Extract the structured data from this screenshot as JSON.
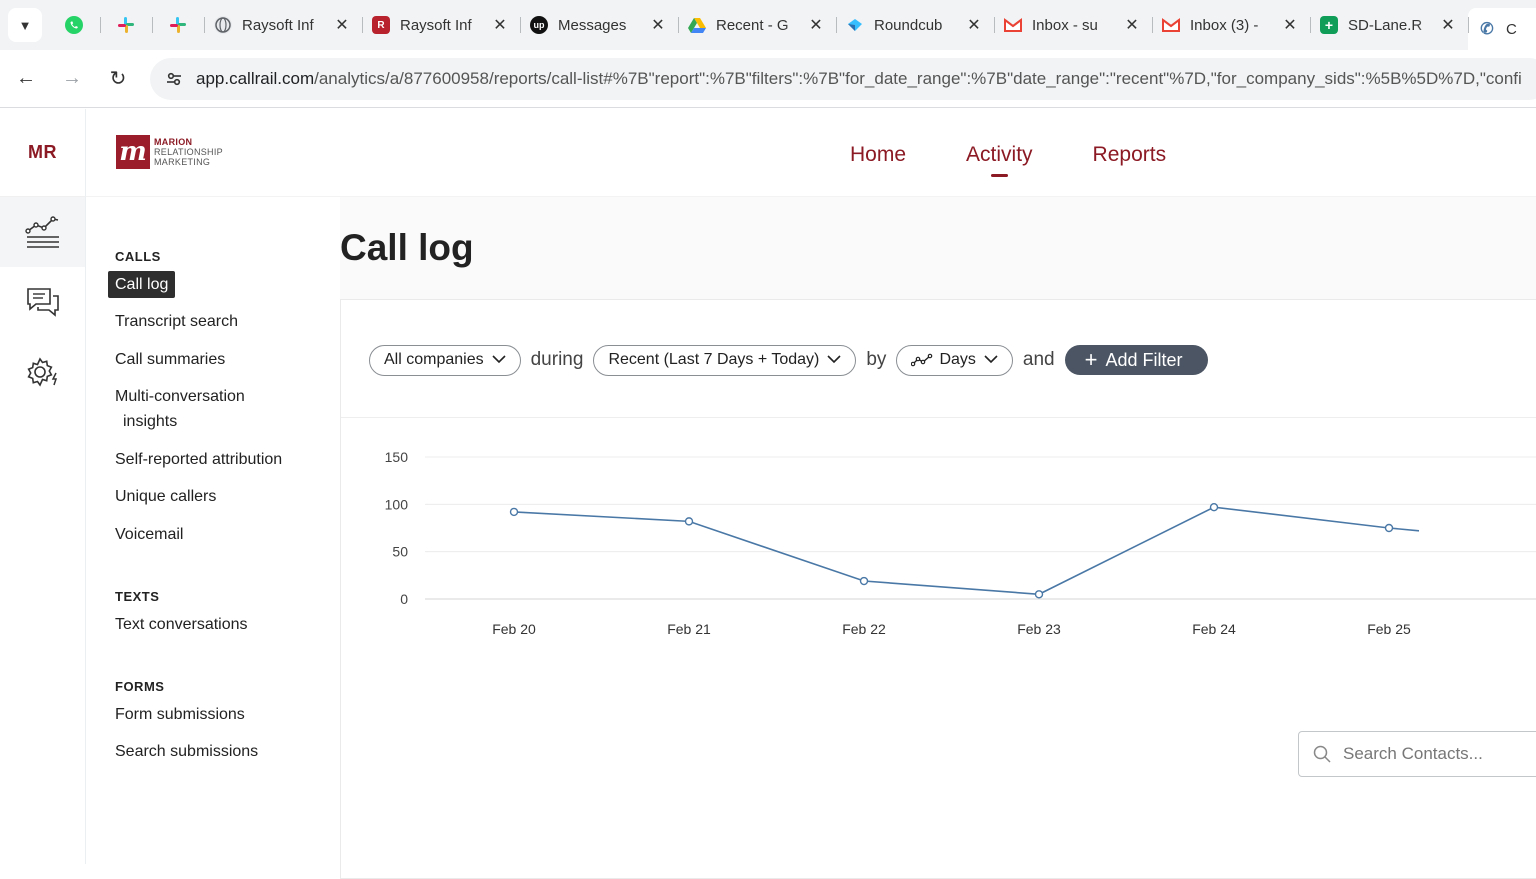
{
  "browser": {
    "tabs": [
      {
        "title": "Raysoft Inf",
        "favicon": "globe-icon"
      },
      {
        "title": "Raysoft Inf",
        "favicon": "raysoft-icon"
      },
      {
        "title": "Messages",
        "favicon": "upwork-icon"
      },
      {
        "title": "Recent - G",
        "favicon": "drive-icon"
      },
      {
        "title": "Roundcub",
        "favicon": "roundcube-icon"
      },
      {
        "title": "Inbox - su",
        "favicon": "gmail-icon"
      },
      {
        "title": "Inbox (3) -",
        "favicon": "gmail-icon"
      },
      {
        "title": "SD-Lane.R",
        "favicon": "sheets-icon"
      },
      {
        "title": "C",
        "favicon": "callrail-icon"
      }
    ],
    "url_host": "app.callrail.com",
    "url_rest": "/analytics/a/877600958/reports/call-list#%7B\"report\":%7B\"filters\":%7B\"for_date_range\":%7B\"date_range\":\"recent\"%7D,\"for_company_sids\":%5B%5D%7D,\"confi"
  },
  "rail": {
    "initials": "MR"
  },
  "logo": {
    "line1": "MARION",
    "line2": "RELATIONSHIP",
    "line3": "MARKETING",
    "mark": "m"
  },
  "nav": {
    "home": "Home",
    "activity": "Activity",
    "reports": "Reports"
  },
  "subnav": {
    "calls_header": "CALLS",
    "call_log": "Call log",
    "transcript_search": "Transcript search",
    "call_summaries": "Call summaries",
    "multi_line1": "Multi-conversation",
    "multi_line2": "insights",
    "self_reported": "Self-reported attribution",
    "unique_callers": "Unique callers",
    "voicemail": "Voicemail",
    "texts_header": "TEXTS",
    "text_conversations": "Text conversations",
    "forms_header": "FORMS",
    "form_submissions": "Form submissions",
    "search_submissions": "Search submissions"
  },
  "page": {
    "title": "Call log"
  },
  "filters": {
    "company": "All companies",
    "during": "during",
    "date_range": "Recent (Last 7 Days + Today)",
    "by": "by",
    "interval": "Days",
    "and": "and",
    "add_filter": "Add Filter"
  },
  "search": {
    "placeholder": "Search Contacts..."
  },
  "colors": {
    "brand": "#8b1a24",
    "line": "#4a78a6"
  },
  "chart_data": {
    "type": "line",
    "categories": [
      "Feb 20",
      "Feb 21",
      "Feb 22",
      "Feb 23",
      "Feb 24",
      "Feb 25"
    ],
    "series": [
      {
        "values": [
          92,
          82,
          19,
          5,
          97,
          75
        ],
        "trailing_value": 72
      }
    ],
    "yticks": [
      0,
      50,
      100,
      150
    ],
    "ylim": [
      0,
      150
    ],
    "grid": true
  }
}
